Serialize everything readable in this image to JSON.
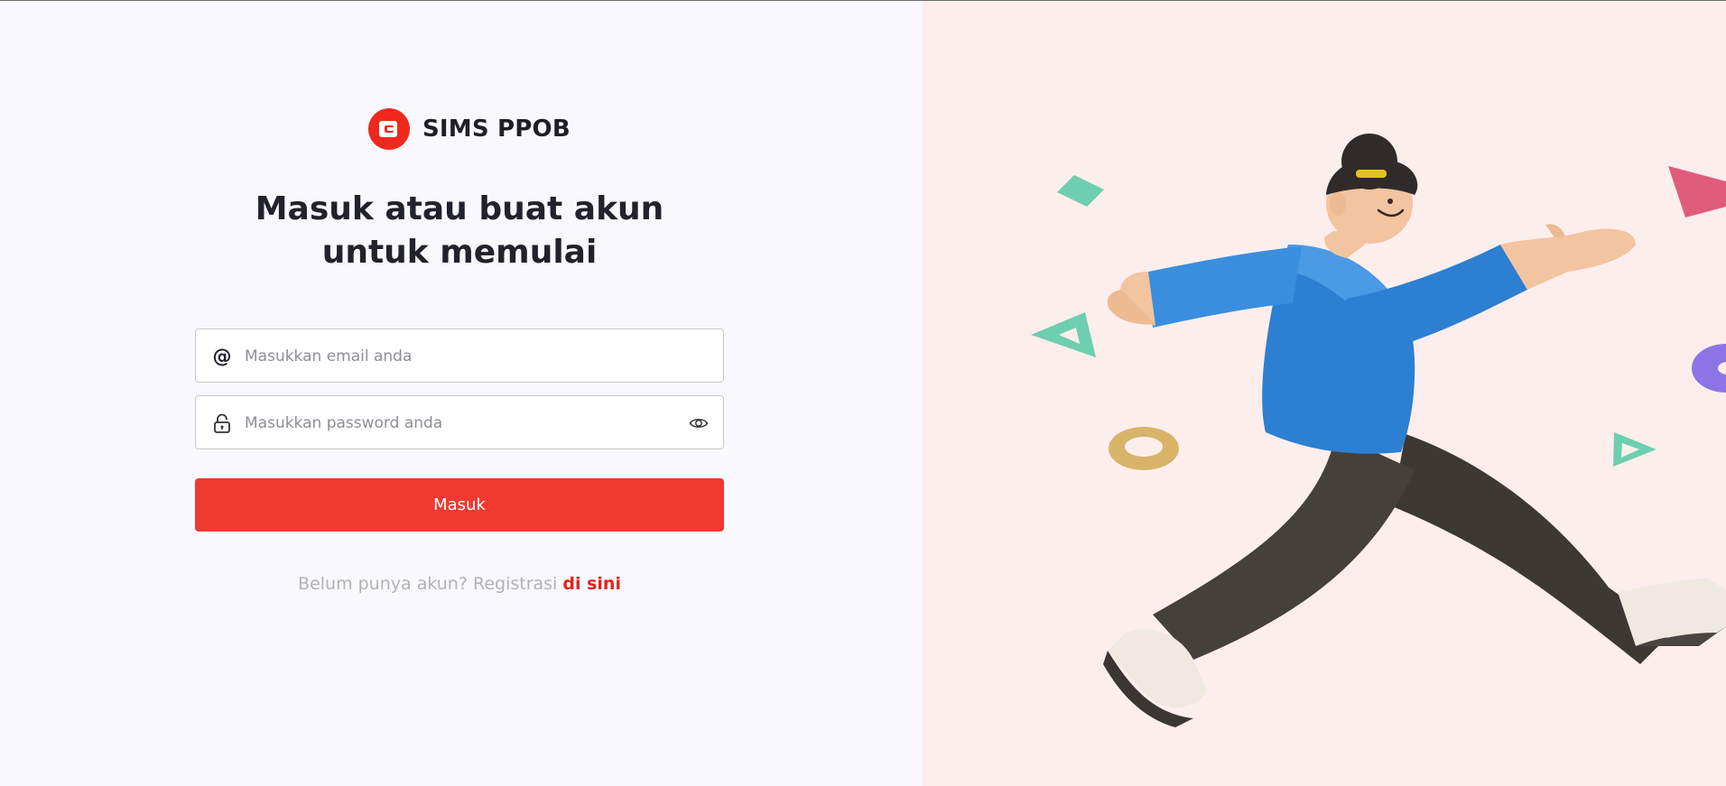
{
  "brand": {
    "name": "SIMS PPOB",
    "logo_icon": "wallet-icon",
    "color": "#f0291f"
  },
  "headline": {
    "line1": "Masuk atau buat akun",
    "line2": "untuk memulai"
  },
  "login_form": {
    "email_placeholder": "Masukkan email anda",
    "email_icon": "at-sign-icon",
    "password_placeholder": "Masukkan password anda",
    "password_icon": "lock-icon",
    "toggle_icon": "eye-icon",
    "submit_label": "Masuk"
  },
  "register": {
    "prompt": "Belum punya akun? Registrasi",
    "link_label": "di sini"
  },
  "colors": {
    "accent": "#f0392f",
    "left_background": "#f8f8fe",
    "right_background": "#fdeeee"
  }
}
